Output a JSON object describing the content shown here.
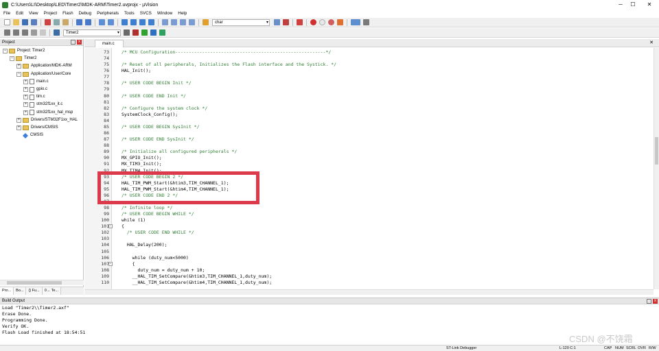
{
  "window": {
    "title": "C:\\Users\\LI\\Desktop\\LED\\Timer2\\MDK-ARM\\Timer2.uvprojx - µVision",
    "minimize": "─",
    "maximize": "☐",
    "close": "✕"
  },
  "menu": [
    "File",
    "Edit",
    "View",
    "Project",
    "Flash",
    "Debug",
    "Peripherals",
    "Tools",
    "SVCS",
    "Window",
    "Help"
  ],
  "toolbar": {
    "find_value": "char",
    "target_value": "Timer2"
  },
  "project_panel": {
    "header": "Project",
    "pin": "",
    "close": "x",
    "tree": [
      {
        "label": "Project: Timer2",
        "indent": 0,
        "kind": "project",
        "exp": "−"
      },
      {
        "label": "Timer2",
        "indent": 1,
        "kind": "folder",
        "exp": "−"
      },
      {
        "label": "Application/MDK-ARM",
        "indent": 2,
        "kind": "folder",
        "exp": "+"
      },
      {
        "label": "Application/User/Core",
        "indent": 2,
        "kind": "folder",
        "exp": "−"
      },
      {
        "label": "main.c",
        "indent": 3,
        "kind": "file",
        "exp": "+"
      },
      {
        "label": "gpio.c",
        "indent": 3,
        "kind": "file",
        "exp": "+"
      },
      {
        "label": "tim.c",
        "indent": 3,
        "kind": "file",
        "exp": "+"
      },
      {
        "label": "stm32f1xx_it.c",
        "indent": 3,
        "kind": "file",
        "exp": "+"
      },
      {
        "label": "stm32f1xx_hal_msp",
        "indent": 3,
        "kind": "file",
        "exp": "+"
      },
      {
        "label": "Drivers/STM32F1xx_HAL",
        "indent": 2,
        "kind": "folder",
        "exp": "+"
      },
      {
        "label": "Drivers/CMSIS",
        "indent": 2,
        "kind": "folder",
        "exp": "+"
      },
      {
        "label": "CMSIS",
        "indent": 2,
        "kind": "gem",
        "exp": ""
      }
    ],
    "tabs": [
      "Pro...",
      "Bo...",
      "{} Fu...",
      "0→ Te..."
    ]
  },
  "editor": {
    "tab": "main.c",
    "lines": [
      {
        "n": "73",
        "text": "/* MCU Configuration--------------------------------------------------------*/",
        "kind": "c"
      },
      {
        "n": "74",
        "text": "",
        "kind": "k"
      },
      {
        "n": "75",
        "text": "/* Reset of all peripherals, Initializes the Flash interface and the Systick. */",
        "kind": "c"
      },
      {
        "n": "76",
        "text": "HAL_Init();",
        "kind": "k"
      },
      {
        "n": "77",
        "text": "",
        "kind": "k"
      },
      {
        "n": "78",
        "text": "/* USER CODE BEGIN Init */",
        "kind": "c"
      },
      {
        "n": "79",
        "text": "",
        "kind": "k"
      },
      {
        "n": "80",
        "text": "/* USER CODE END Init */",
        "kind": "c"
      },
      {
        "n": "81",
        "text": "",
        "kind": "k"
      },
      {
        "n": "82",
        "text": "/* Configure the system clock */",
        "kind": "c"
      },
      {
        "n": "83",
        "text": "SystemClock_Config();",
        "kind": "k"
      },
      {
        "n": "84",
        "text": "",
        "kind": "k"
      },
      {
        "n": "85",
        "text": "/* USER CODE BEGIN SysInit */",
        "kind": "c"
      },
      {
        "n": "86",
        "text": "",
        "kind": "k"
      },
      {
        "n": "87",
        "text": "/* USER CODE END SysInit */",
        "kind": "c"
      },
      {
        "n": "88",
        "text": "",
        "kind": "k"
      },
      {
        "n": "89",
        "text": "/* Initialize all configured peripherals */",
        "kind": "c"
      },
      {
        "n": "90",
        "text": "MX_GPIO_Init();",
        "kind": "k"
      },
      {
        "n": "91",
        "text": "MX_TIM3_Init();",
        "kind": "k"
      },
      {
        "n": "92",
        "text": "MX_TIM4_Init();",
        "kind": "k"
      },
      {
        "n": "93",
        "text": "/* USER CODE BEGIN 2 */",
        "kind": "c"
      },
      {
        "n": "94",
        "text": "HAL_TIM_PWM_Start(&htim3,TIM_CHANNEL_1);",
        "kind": "k"
      },
      {
        "n": "95",
        "text": "HAL_TIM_PWM_Start(&htim4,TIM_CHANNEL_1);",
        "kind": "k"
      },
      {
        "n": "96",
        "text": "/* USER CODE END 2 */",
        "kind": "c"
      },
      {
        "n": "97",
        "text": "",
        "kind": "k"
      },
      {
        "n": "98",
        "text": "/* Infinite loop */",
        "kind": "c"
      },
      {
        "n": "99",
        "text": "/* USER CODE BEGIN WHILE */",
        "kind": "c"
      },
      {
        "n": "100",
        "text": "while (1)",
        "kind": "k"
      },
      {
        "n": "101",
        "text": "{",
        "kind": "k",
        "fold": "−"
      },
      {
        "n": "102",
        "text": "  /* USER CODE END WHILE */",
        "kind": "c"
      },
      {
        "n": "103",
        "text": "",
        "kind": "k"
      },
      {
        "n": "104",
        "text": "  HAL_Delay(200);",
        "kind": "k"
      },
      {
        "n": "105",
        "text": "",
        "kind": "k"
      },
      {
        "n": "106",
        "text": "    while (duty_num<5000)",
        "kind": "k"
      },
      {
        "n": "107",
        "text": "    {",
        "kind": "k",
        "fold": "−"
      },
      {
        "n": "108",
        "text": "      duty_num = duty_num + 10;",
        "kind": "k"
      },
      {
        "n": "109",
        "text": "    __HAL_TIM_SetCompare(&htim3,TIM_CHANNEL_1,duty_num);",
        "kind": "k"
      },
      {
        "n": "110",
        "text": "    __HAL_TIM_SetCompare(&htim4,TIM_CHANNEL_1,duty_num);",
        "kind": "k"
      }
    ]
  },
  "build": {
    "header": "Build Output",
    "lines": [
      "Load \"Timer2\\\\Timer2.axf\"",
      "Erase Done.",
      "Programming Done.",
      "Verify OK.",
      "Flash Load finished at 18:54:51"
    ]
  },
  "status": {
    "debugger": "ST-Link Debugger",
    "position": "L:120 C:1",
    "cap": "CAP",
    "num": "NUM",
    "scrl": "SCRL",
    "ovr": "OVR",
    "rw": "R/W"
  },
  "watermark": "CSDN @不饶霜",
  "colors": {
    "highlight": "#dc3a4a",
    "comment": "#2e7d32"
  }
}
